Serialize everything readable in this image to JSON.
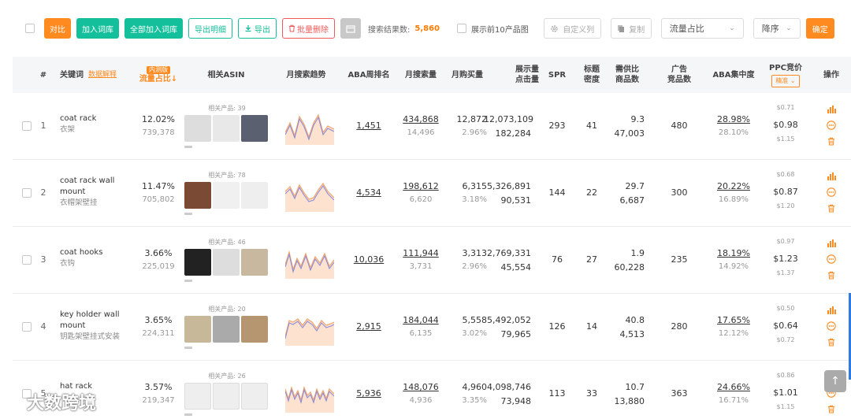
{
  "toolbar": {
    "compare": "对比",
    "add_lexicon": "加入词库",
    "add_all_lexicon": "全部加入词库",
    "export_detail": "导出明细",
    "export": "导出",
    "batch_delete": "批量删除",
    "search_result_label": "搜索结果数:",
    "search_result_count": "5,860",
    "show_top10": "展示前10产品图",
    "custom_columns": "自定义列",
    "copy": "复制",
    "sort_field": "流量占比",
    "sort_order": "降序",
    "confirm": "确定"
  },
  "headers": {
    "index": "#",
    "keyword": "关键词",
    "data_explain": "数据解释",
    "badge": "内测版",
    "traffic_share": "流量占比↓",
    "related_asin": "相关ASIN",
    "monthly_trend": "月搜索趋势",
    "aba_rank": "ABA周排名",
    "monthly_search": "月搜索量",
    "monthly_purchase": "月购买量",
    "impressions": "展示量",
    "clicks": "点击量",
    "spr": "SPR",
    "title_density": "标题",
    "title_density2": "密度",
    "supply_demand": "需供比",
    "product_count": "商品数",
    "ad_products": "广告",
    "ad_products2": "竞品数",
    "aba_concentration": "ABA集中度",
    "ppc_bid": "PPC竞价",
    "ppc_mode": "精准",
    "operations": "操作"
  },
  "rows": [
    {
      "index": "1",
      "keyword": "coat rack",
      "keyword_cn": "衣架",
      "traffic_share": "12.02%",
      "traffic_volume": "739,378",
      "related_count": "相关产品: 39",
      "aba_rank": "1,451",
      "monthly_search": "434,868",
      "monthly_search_sub": "14,496",
      "monthly_purchase": "12,872",
      "purchase_rate": "2.96%",
      "impressions": "12,073,109",
      "clicks": "182,284",
      "spr": "293",
      "title_density": "41",
      "supply_demand": "9.3",
      "product_count": "47,003",
      "ad_products": "480",
      "aba_concentration": "28.98%",
      "aba_concentration_sub": "28.10%",
      "ppc_high": "$0.71",
      "ppc_mid": "$0.98",
      "ppc_low": "$1.15"
    },
    {
      "index": "2",
      "keyword": "coat rack wall mount",
      "keyword_cn": "衣帽架壁挂",
      "traffic_share": "11.47%",
      "traffic_volume": "705,802",
      "related_count": "相关产品: 78",
      "aba_rank": "4,534",
      "monthly_search": "198,612",
      "monthly_search_sub": "6,620",
      "monthly_purchase": "6,315",
      "purchase_rate": "3.18%",
      "impressions": "5,326,891",
      "clicks": "90,531",
      "spr": "144",
      "title_density": "22",
      "supply_demand": "29.7",
      "product_count": "6,687",
      "ad_products": "300",
      "aba_concentration": "20.22%",
      "aba_concentration_sub": "16.89%",
      "ppc_high": "$0.68",
      "ppc_mid": "$0.87",
      "ppc_low": "$1.20"
    },
    {
      "index": "3",
      "keyword": "coat hooks",
      "keyword_cn": "衣钩",
      "traffic_share": "3.66%",
      "traffic_volume": "225,019",
      "related_count": "相关产品: 46",
      "aba_rank": "10,036",
      "monthly_search": "111,944",
      "monthly_search_sub": "3,731",
      "monthly_purchase": "3,313",
      "purchase_rate": "2.96%",
      "impressions": "2,769,331",
      "clicks": "45,554",
      "spr": "76",
      "title_density": "27",
      "supply_demand": "1.9",
      "product_count": "60,228",
      "ad_products": "235",
      "aba_concentration": "18.19%",
      "aba_concentration_sub": "14.92%",
      "ppc_high": "$0.97",
      "ppc_mid": "$1.23",
      "ppc_low": "$1.37"
    },
    {
      "index": "4",
      "keyword": "key holder wall mount",
      "keyword_cn": "钥匙架壁挂式安装",
      "traffic_share": "3.65%",
      "traffic_volume": "224,311",
      "related_count": "相关产品: 20",
      "aba_rank": "2,915",
      "monthly_search": "184,044",
      "monthly_search_sub": "6,135",
      "monthly_purchase": "5,558",
      "purchase_rate": "3.02%",
      "impressions": "5,492,052",
      "clicks": "79,965",
      "spr": "126",
      "title_density": "14",
      "supply_demand": "40.8",
      "product_count": "4,513",
      "ad_products": "280",
      "aba_concentration": "17.65%",
      "aba_concentration_sub": "12.12%",
      "ppc_high": "$0.50",
      "ppc_mid": "$0.64",
      "ppc_low": "$0.72"
    },
    {
      "index": "5",
      "keyword": "hat rack",
      "keyword_cn": "",
      "traffic_share": "3.57%",
      "traffic_volume": "219,347",
      "related_count": "相关产品: 26",
      "aba_rank": "5,936",
      "monthly_search": "148,076",
      "monthly_search_sub": "4,936",
      "monthly_purchase": "4,960",
      "purchase_rate": "3.35%",
      "impressions": "4,098,746",
      "clicks": "73,948",
      "spr": "113",
      "title_density": "33",
      "supply_demand": "10.7",
      "product_count": "13,880",
      "ad_products": "363",
      "aba_concentration": "24.66%",
      "aba_concentration_sub": "16.71%",
      "ppc_high": "$0.86",
      "ppc_mid": "$1.01",
      "ppc_low": "$1.15"
    }
  ],
  "watermark": "大数跨境",
  "icons": [
    "gear-icon",
    "copy-icon",
    "calendar-icon",
    "download-icon",
    "trash-icon",
    "bar-chart-icon",
    "more-icon",
    "arrow-up-icon"
  ],
  "colors": {
    "accent": "#ff8a1f",
    "teal": "#14c09b",
    "red": "#f05a5a",
    "trend_orange": "#f4a46a",
    "trend_blue": "#8c8cdc"
  }
}
